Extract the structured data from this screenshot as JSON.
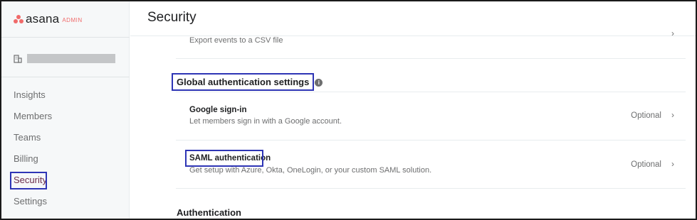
{
  "app": {
    "logo_text": "asana",
    "logo_badge": "ADMIN"
  },
  "sidebar": {
    "items": [
      {
        "label": "Insights"
      },
      {
        "label": "Members"
      },
      {
        "label": "Teams"
      },
      {
        "label": "Billing"
      },
      {
        "label": "Security",
        "active": true
      },
      {
        "label": "Settings"
      }
    ]
  },
  "header": {
    "title": "Security"
  },
  "main": {
    "export_row": {
      "description": "Export events to a CSV file"
    },
    "global_auth": {
      "title": "Global authentication settings",
      "info_icon": "info-icon",
      "rows": [
        {
          "title": "Google sign-in",
          "description": "Let members sign in with a Google account.",
          "status": "Optional"
        },
        {
          "title": "SAML authentication",
          "description": "Get setup with Azure, Okta, OneLogin, or your custom SAML solution.",
          "status": "Optional"
        }
      ]
    },
    "authentication": {
      "title": "Authentication"
    }
  },
  "colors": {
    "brand": "#f06a6a",
    "highlight_box": "#2e35b5",
    "active_nav": "#6b2d4a",
    "sidebar_bg": "#f6f8f9"
  }
}
